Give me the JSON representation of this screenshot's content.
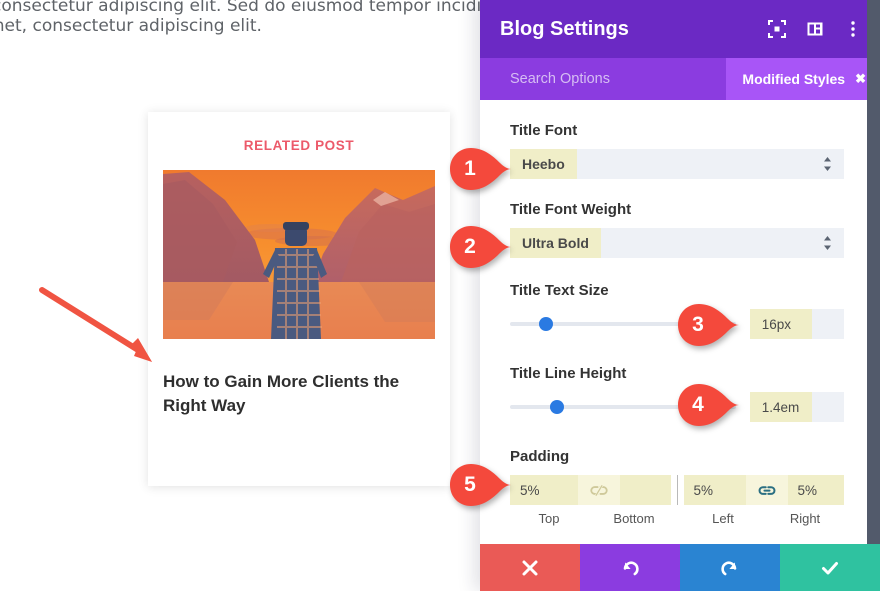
{
  "page_preview": {
    "clipped_text_line1": "um dolor sit amet, consectetur adipiscing elit. Sed do eiusmod tempor incididunt ut labore et dolore magna aliqua. Ut enim",
    "clipped_text_line2": "met, consectetur adipiscing elit.",
    "related_label": "RELATED POST",
    "post_title": "How to Gain More Clients the Right Way",
    "thumbnail_alt": "sunset-mountain-lake-photo"
  },
  "panel": {
    "header": {
      "title": "Blog Settings",
      "icons": [
        {
          "name": "focus-target-icon"
        },
        {
          "name": "panel-layout-icon"
        },
        {
          "name": "more-options-icon"
        }
      ]
    },
    "search": {
      "placeholder": "Search Options",
      "chip_label": "Modified Styles",
      "chip_close": "✖"
    },
    "fields": {
      "title_font": {
        "label": "Title Font",
        "value": "Heebo"
      },
      "title_font_weight": {
        "label": "Title Font Weight",
        "value": "Ultra Bold"
      },
      "title_text_size": {
        "label": "Title Text Size",
        "value": "16px",
        "slider_percent": 16
      },
      "title_line_height": {
        "label": "Title Line Height",
        "value": "1.4em",
        "slider_percent": 21
      },
      "padding": {
        "label": "Padding",
        "top": {
          "label": "Top",
          "value": "5%"
        },
        "bottom": {
          "label": "Bottom",
          "value": ""
        },
        "left": {
          "label": "Left",
          "value": "5%"
        },
        "right": {
          "label": "Right",
          "value": "5%"
        },
        "link_top_bottom_icon": "chain-broken-icon",
        "link_left_right_icon": "chain-linked-icon"
      }
    },
    "footer": {
      "cancel": {
        "name": "cancel-button",
        "glyph": "✖"
      },
      "undo": {
        "name": "undo-button",
        "glyph": "↺"
      },
      "redo": {
        "name": "redo-button",
        "glyph": "↻"
      },
      "save": {
        "name": "save-button",
        "glyph": "✔"
      }
    }
  },
  "annotations": {
    "pins": [
      {
        "number": "1"
      },
      {
        "number": "2"
      },
      {
        "number": "3"
      },
      {
        "number": "4"
      },
      {
        "number": "5"
      }
    ],
    "arrow": {
      "name": "pointer-arrow",
      "color": "#f05442"
    }
  },
  "colors": {
    "panel_header": "#6b29c4",
    "search_bar": "#8b3ce0",
    "chip": "#a855f7",
    "highlight_field": "#f0eec8",
    "slider_knob": "#2a7ae2",
    "pin": "#f4493c",
    "related_label": "#ec5a6a",
    "btn_cancel": "#ea5a56",
    "btn_undo": "#8b3ce0",
    "btn_redo": "#2a84d2",
    "btn_save": "#2fc2a0"
  }
}
